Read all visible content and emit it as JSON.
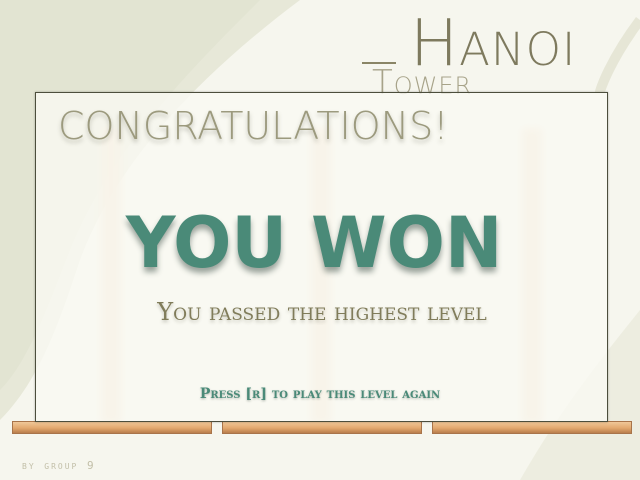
{
  "title": {
    "word1": "Tower",
    "word2": "Hanoi"
  },
  "dialog": {
    "heading": "CONGRATULATIONS!",
    "headline": "YOU WON",
    "subtitle": "You passed the highest level",
    "prompt": "Press [r] to play this level again"
  },
  "footer": {
    "credit": "by group 9"
  },
  "colors": {
    "accent": "#4a8a78",
    "muted_text": "#9c9a7e",
    "background": "#f6f6ee",
    "base_wood": "#e2a86e"
  }
}
